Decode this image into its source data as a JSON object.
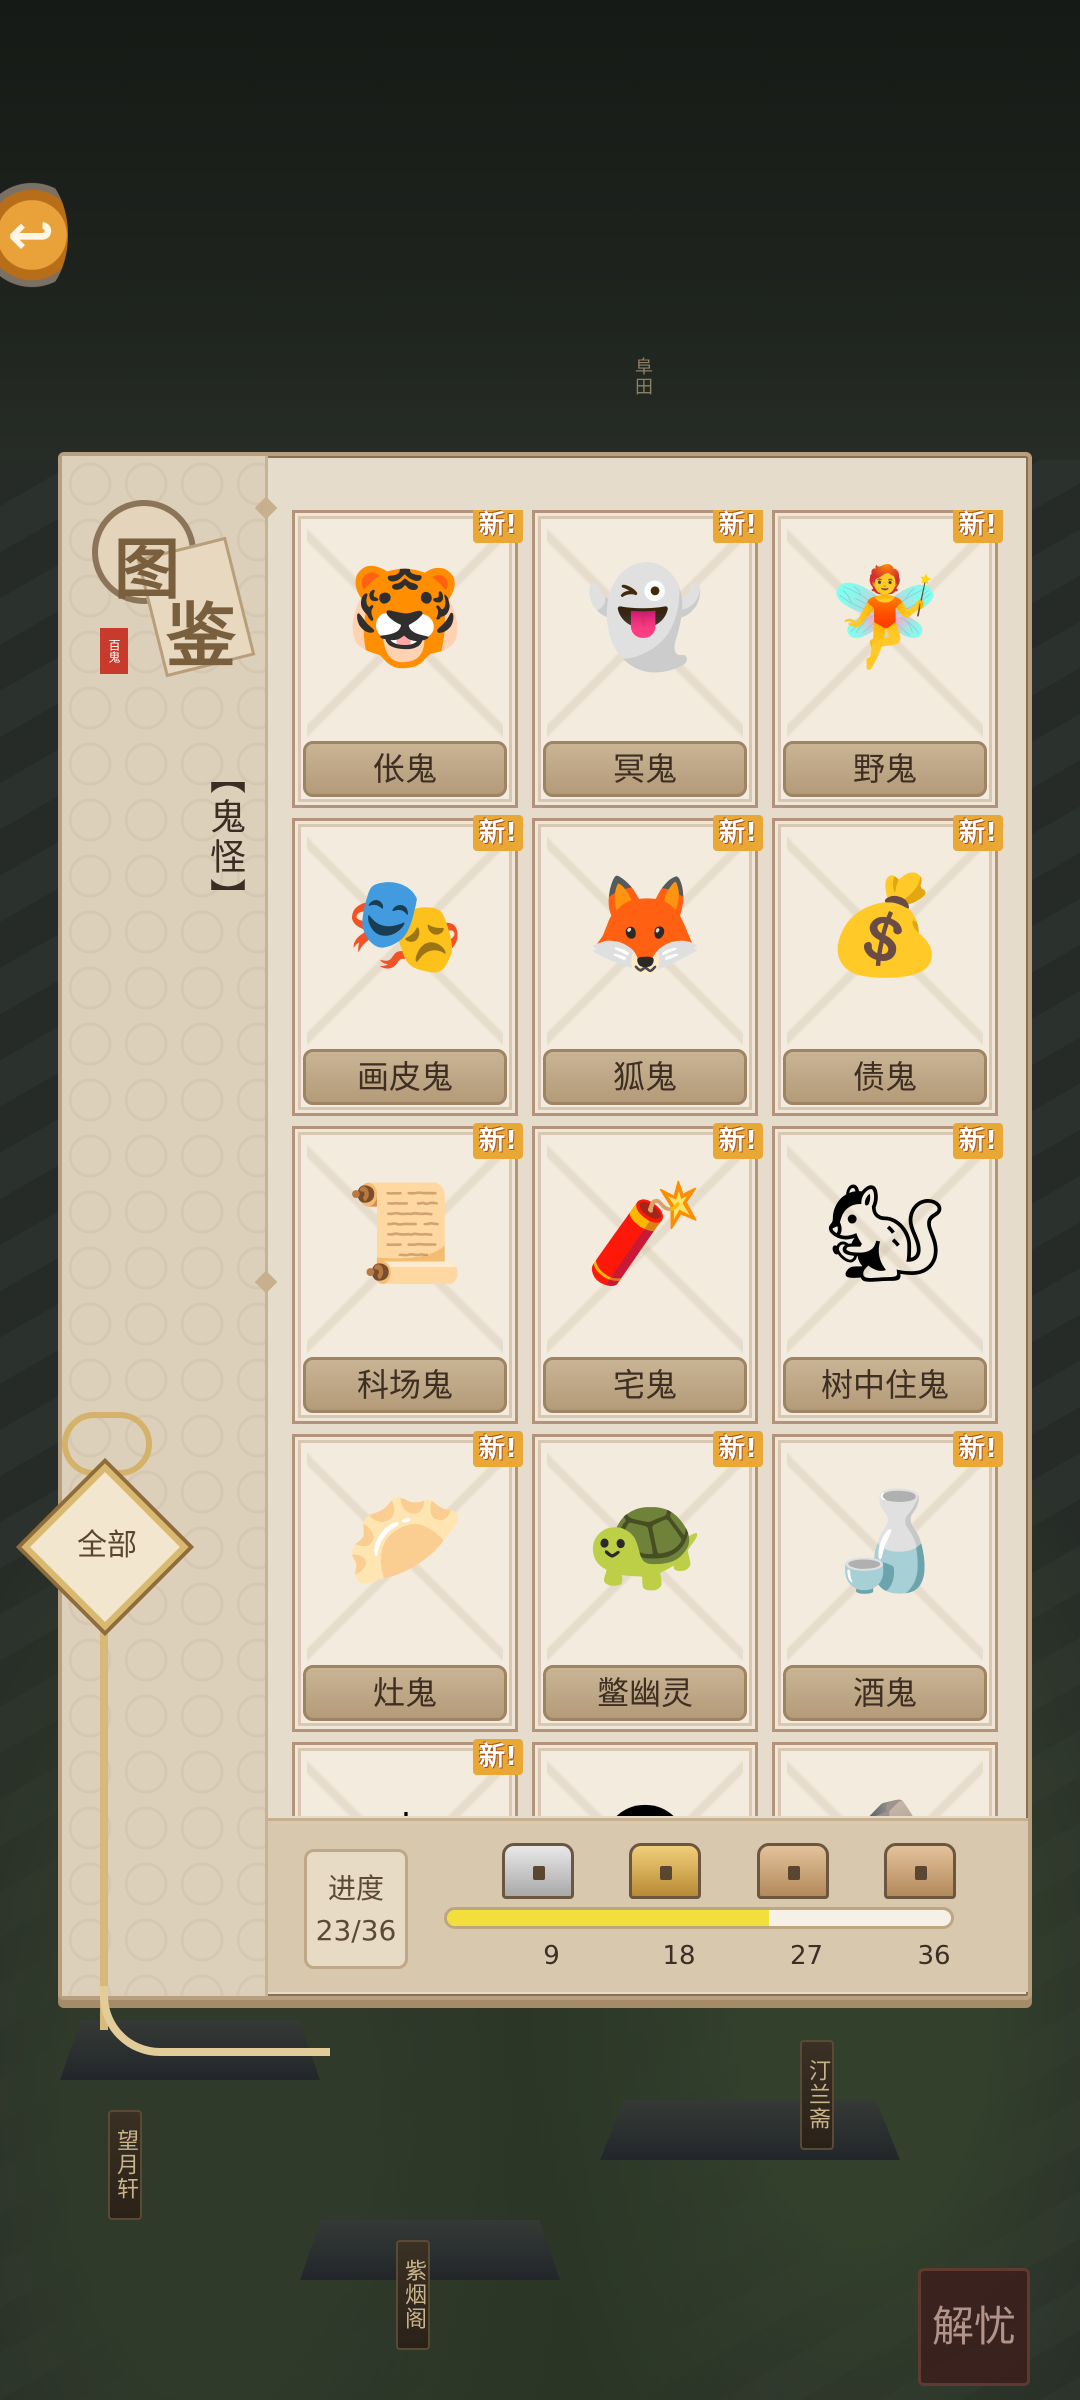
{
  "background": {
    "signs": [
      "阜田",
      "望月轩",
      "紫烟阁",
      "汀兰斋"
    ],
    "seal_text": "解忧"
  },
  "codex": {
    "title_chars": [
      "图",
      "鉴"
    ],
    "stamp_text": "百鬼",
    "category": "【鬼怪】",
    "filter_label": "全部",
    "new_badge": "新!",
    "cards": [
      {
        "name": "伥鬼",
        "icon": "tiger-ghost-art",
        "glyph": "🐯",
        "is_new": true
      },
      {
        "name": "冥鬼",
        "icon": "blue-flame-ghost-art",
        "glyph": "👻",
        "is_new": true
      },
      {
        "name": "野鬼",
        "icon": "girl-ghost-art",
        "glyph": "🧚",
        "is_new": true
      },
      {
        "name": "画皮鬼",
        "icon": "opera-mask-ghost-art",
        "glyph": "🎭",
        "is_new": true
      },
      {
        "name": "狐鬼",
        "icon": "fox-ghost-art",
        "glyph": "🦊",
        "is_new": true
      },
      {
        "name": "债鬼",
        "icon": "debt-sack-ghost-art",
        "glyph": "💰",
        "is_new": true
      },
      {
        "name": "科场鬼",
        "icon": "scholar-ghost-art",
        "glyph": "📜",
        "is_new": true
      },
      {
        "name": "宅鬼",
        "icon": "umbrella-ghost-art",
        "glyph": "🧨",
        "is_new": true
      },
      {
        "name": "树中住鬼",
        "icon": "squirrel-art",
        "glyph": "🐿",
        "is_new": true
      },
      {
        "name": "灶鬼",
        "icon": "cook-ghost-art",
        "glyph": "🥟",
        "is_new": true
      },
      {
        "name": "鳖幽灵",
        "icon": "turtle-spirit-art",
        "glyph": "🐢",
        "is_new": true
      },
      {
        "name": "酒鬼",
        "icon": "drunk-ghost-art",
        "glyph": "🍶",
        "is_new": true
      },
      {
        "name": "",
        "icon": "parasol-ghost-art",
        "glyph": "☂",
        "is_new": true
      },
      {
        "name": "",
        "icon": "dark-ghost-art",
        "glyph": "🌑",
        "is_new": false
      },
      {
        "name": "",
        "icon": "rock-ghost-art",
        "glyph": "🪨",
        "is_new": false
      }
    ]
  },
  "progress": {
    "label": "进度",
    "value_text": "23/36",
    "current": 23,
    "total": 36,
    "milestones": [
      {
        "value": 9,
        "label": "9",
        "chest": "silver"
      },
      {
        "value": 18,
        "label": "18",
        "chest": "gold"
      },
      {
        "value": 27,
        "label": "27",
        "chest": "wood"
      },
      {
        "value": 36,
        "label": "36",
        "chest": "wood"
      }
    ]
  },
  "colors": {
    "accent": "#e9a736",
    "progress_fill": "#f2df3c",
    "panel": "#e6dccb"
  }
}
